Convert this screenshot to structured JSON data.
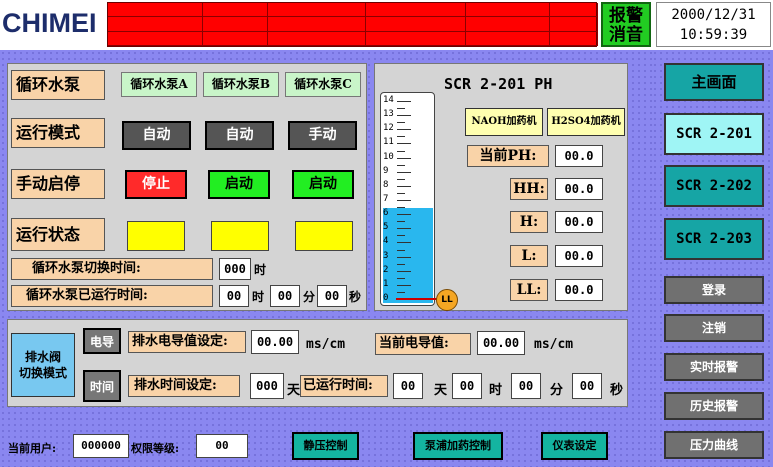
{
  "header": {
    "logo": "CHIMEI",
    "ack_line1": "报警",
    "ack_line2": "消音",
    "date": "2000/12/31",
    "time": "10:59:39"
  },
  "pumps": {
    "row_label": "循环水泵",
    "names": [
      "循环水泵A",
      "循环水泵B",
      "循环水泵C"
    ],
    "mode_label": "运行模式",
    "modes": [
      "自动",
      "自动",
      "手动"
    ],
    "manual_label": "手动启停",
    "manual": [
      "停止",
      "启动",
      "启动"
    ],
    "status_label": "运行状态",
    "switch_time_label": "循环水泵切换时间:",
    "switch_time": "000",
    "switch_unit": "时",
    "run_time_label": "循环水泵已运行时间:",
    "run_h": "00",
    "h_unit": "时",
    "run_m": "00",
    "m_unit": "分",
    "run_s": "00",
    "s_unit": "秒",
    "colors": {
      "stop": "#ff2a2a",
      "start": "#22ee22",
      "auto": "#555555",
      "status": "#ffff00"
    }
  },
  "ph": {
    "title": "SCR 2-201 PH",
    "naoh": "NAOH加药机",
    "h2so4": "H2SO4加药机",
    "current_label": "当前PH:",
    "current": "00.0",
    "hh_label": "HH:",
    "hh": "00.0",
    "h_label": "H:",
    "h": "00.0",
    "l_label": "L:",
    "l": "00.0",
    "ll_label": "LL:",
    "ll": "00.0",
    "gauge_ticks": [
      "14",
      "13",
      "12",
      "11",
      "10",
      "9",
      "8",
      "7",
      "6",
      "5",
      "4",
      "3",
      "2",
      "1",
      "0"
    ],
    "level": 6.3,
    "ll_marker": "LL"
  },
  "drain": {
    "mode_label_1": "排水阀",
    "mode_label_2": "切换模式",
    "cond_btn": "电导",
    "time_btn": "时间",
    "cond_set_label": "排水电导值设定:",
    "cond_set": "00.00",
    "cond_unit": "ms/cm",
    "cond_cur_label": "当前电导值:",
    "cond_cur": "00.00",
    "cond_cur_unit": "ms/cm",
    "time_set_label": "排水时间设定:",
    "time_set": "000",
    "day_unit": "天",
    "run_label": "已运行时间:",
    "run_d": "00",
    "run_d_unit": "天",
    "run_h": "00",
    "run_h_unit": "时",
    "run_m": "00",
    "run_m_unit": "分",
    "run_s": "00",
    "run_s_unit": "秒"
  },
  "footer": {
    "user_label": "当前用户:",
    "user": "000000",
    "level_label": "权限等级:",
    "level": "00",
    "static_btn": "静压控制",
    "pump_btn": "泵浦加药控制",
    "meter_btn": "仪表设定"
  },
  "sidebar": {
    "main": "主画面",
    "s1": "SCR 2-201",
    "s2": "SCR 2-202",
    "s3": "SCR 2-203",
    "login": "登录",
    "logout": "注销",
    "realtime": "实时报警",
    "history": "历史报警",
    "pressure": "压力曲线"
  }
}
